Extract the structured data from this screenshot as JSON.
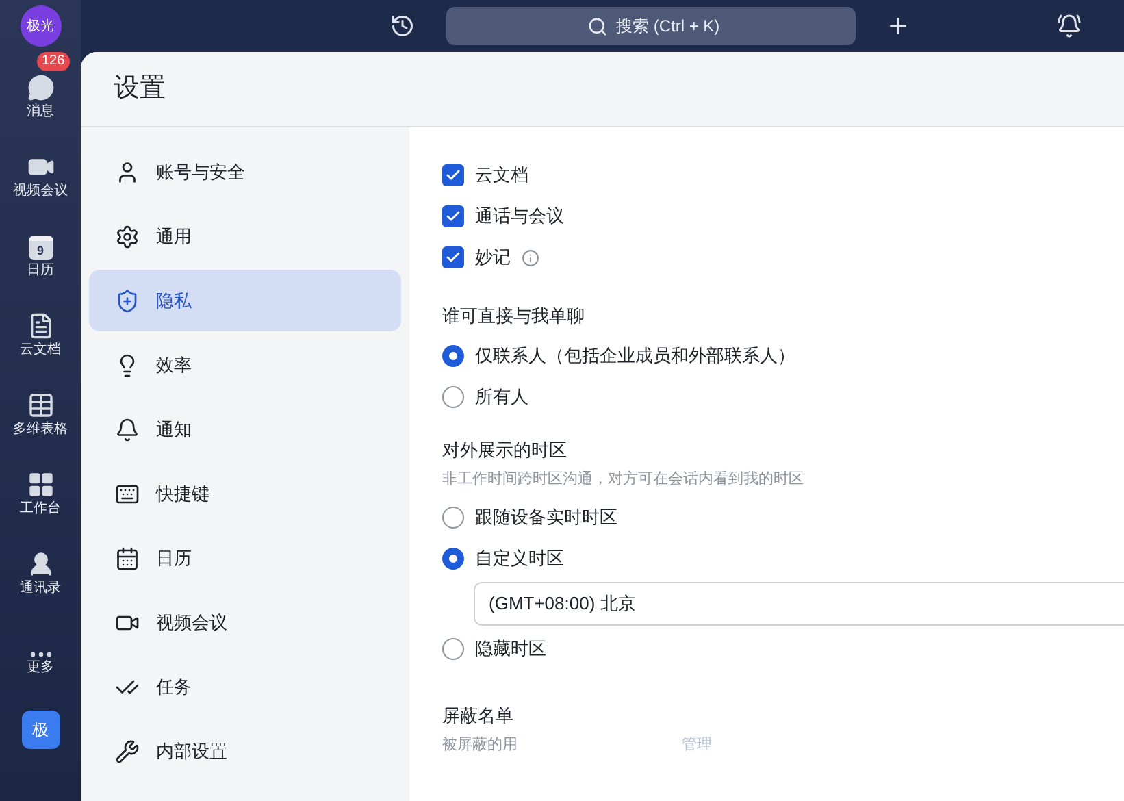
{
  "avatar": "极光",
  "search": {
    "placeholder": "搜索 (Ctrl + K)"
  },
  "rail": [
    {
      "kind": "chat",
      "label": "消息",
      "badge": "126"
    },
    {
      "kind": "video",
      "label": "视频会议"
    },
    {
      "kind": "calendar",
      "label": "日历",
      "day": "9"
    },
    {
      "kind": "docs",
      "label": "云文档"
    },
    {
      "kind": "sheet",
      "label": "多维表格"
    },
    {
      "kind": "apps",
      "label": "工作台"
    },
    {
      "kind": "contacts",
      "label": "通讯录"
    },
    {
      "kind": "more",
      "label": "更多"
    }
  ],
  "org": "极",
  "settings": {
    "title": "设置",
    "nav": [
      {
        "kind": "user",
        "label": "账号与安全",
        "selected": false
      },
      {
        "kind": "gear",
        "label": "通用",
        "selected": false
      },
      {
        "kind": "shield",
        "label": "隐私",
        "selected": true
      },
      {
        "kind": "bulb",
        "label": "效率",
        "selected": false
      },
      {
        "kind": "bell",
        "label": "通知",
        "selected": false
      },
      {
        "kind": "keyboard",
        "label": "快捷键",
        "selected": false
      },
      {
        "kind": "calendar",
        "label": "日历",
        "selected": false
      },
      {
        "kind": "video",
        "label": "视频会议",
        "selected": false
      },
      {
        "kind": "task",
        "label": "任务",
        "selected": false
      },
      {
        "kind": "wrench",
        "label": "内部设置",
        "selected": false
      }
    ],
    "checkboxes": [
      {
        "label": "云文档",
        "checked": true,
        "info": false
      },
      {
        "label": "通话与会议",
        "checked": true,
        "info": false
      },
      {
        "label": "妙记",
        "checked": true,
        "info": true
      }
    ],
    "chat_section": {
      "title": "谁可直接与我单聊",
      "options": [
        {
          "label": "仅联系人（包括企业成员和外部联系人）",
          "selected": true
        },
        {
          "label": "所有人",
          "selected": false
        }
      ]
    },
    "timezone_section": {
      "title": "对外展示的时区",
      "hint": "非工作时间跨时区沟通，对方可在会话内看到我的时区",
      "options": [
        {
          "label": "跟随设备实时时区",
          "selected": false
        },
        {
          "label": "自定义时区",
          "selected": true,
          "value": "(GMT+08:00) 北京"
        },
        {
          "label": "隐藏时区",
          "selected": false
        }
      ]
    },
    "block_section": {
      "title": "屏蔽名单",
      "hint": "被屏蔽的用",
      "link": "管理"
    }
  }
}
